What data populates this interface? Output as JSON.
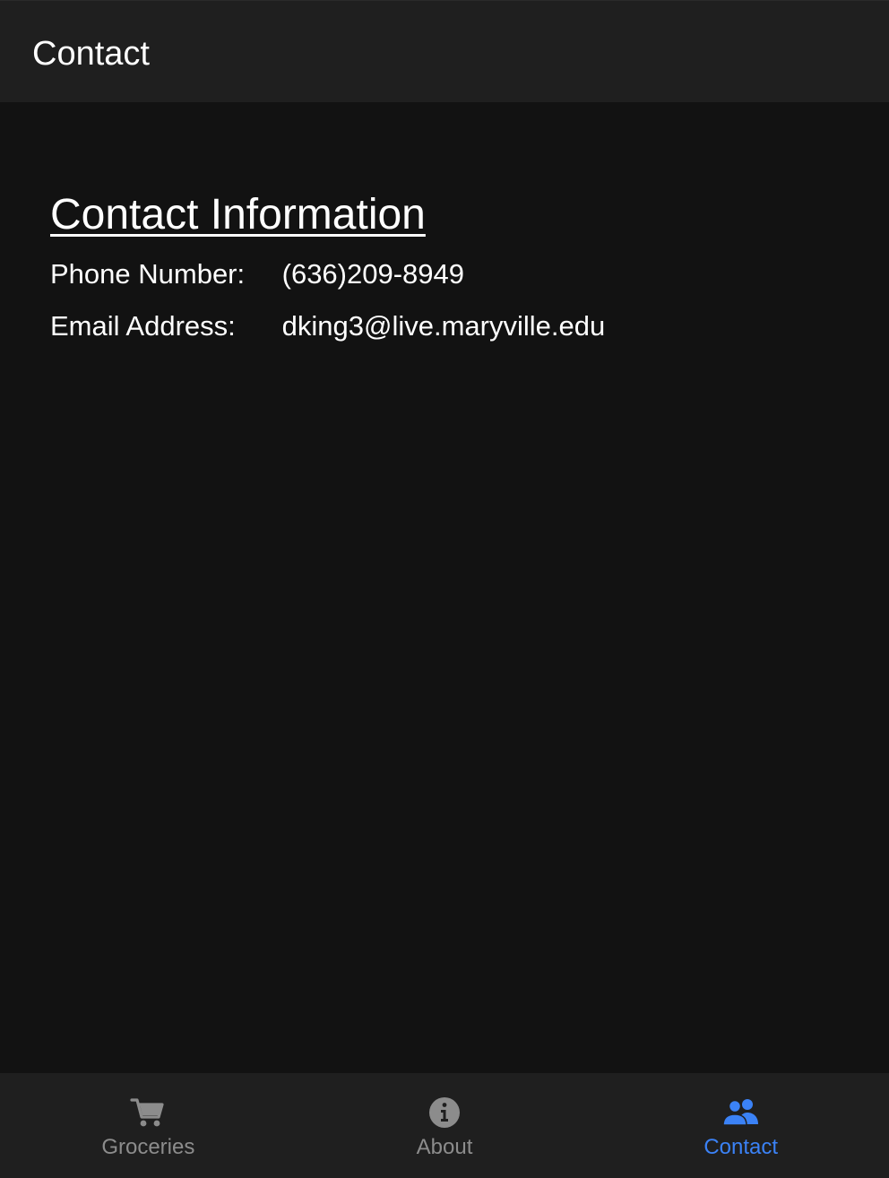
{
  "toolbar": {
    "title": "Contact"
  },
  "contact": {
    "heading": "Contact Information",
    "phone_label": "Phone Number:",
    "phone_value": "(636)209-8949",
    "email_label": "Email Address:",
    "email_value": "dking3@live.maryville.edu"
  },
  "tabs": [
    {
      "label": "Groceries",
      "icon": "cart-icon",
      "active": false
    },
    {
      "label": "About",
      "icon": "info-icon",
      "active": false
    },
    {
      "label": "Contact",
      "icon": "people-icon",
      "active": true
    }
  ],
  "colors": {
    "background": "#121212",
    "bar": "#1f1f1f",
    "accent": "#3b82f6",
    "inactive": "#8c8c8c"
  }
}
